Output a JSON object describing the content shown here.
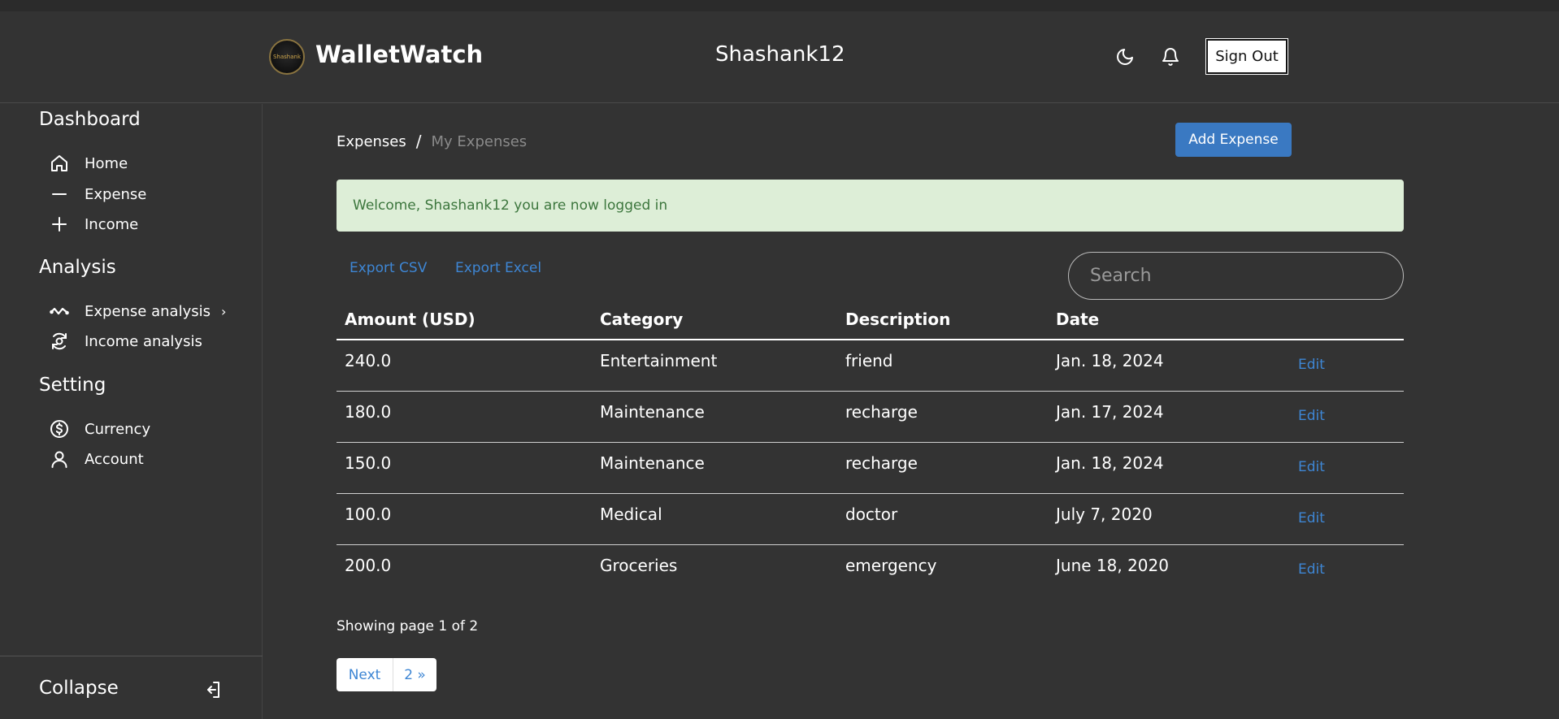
{
  "header": {
    "logo_text": "Shashank",
    "brand": "WalletWatch",
    "username": "Shashank12",
    "sign_out_label": "Sign Out",
    "icons": [
      "moon-icon",
      "bell-icon"
    ]
  },
  "sidebar": {
    "sections": [
      {
        "title": "Dashboard",
        "items": [
          {
            "label": "Home",
            "icon": "home-icon"
          },
          {
            "label": "Expense",
            "icon": "minus-icon"
          },
          {
            "label": "Income",
            "icon": "plus-icon"
          }
        ]
      },
      {
        "title": "Analysis",
        "items": [
          {
            "label": "Expense analysis",
            "icon": "wave-icon"
          },
          {
            "label": "Income analysis",
            "icon": "cycle-icon"
          }
        ]
      },
      {
        "title": "Setting",
        "items": [
          {
            "label": "Currency",
            "icon": "dollar-circle-icon"
          },
          {
            "label": "Account",
            "icon": "user-icon"
          }
        ]
      }
    ],
    "collapse_label": "Collapse"
  },
  "breadcrumb": {
    "root": "Expenses",
    "separator": "/",
    "current": "My Expenses"
  },
  "add_expense_label": "Add Expense",
  "alert_message": "Welcome, Shashank12 you are now logged in",
  "exports": {
    "csv": "Export CSV",
    "excel": "Export Excel"
  },
  "search": {
    "placeholder": "Search"
  },
  "table": {
    "columns": [
      "Amount (USD)",
      "Category",
      "Description",
      "Date"
    ],
    "rows": [
      {
        "amount": "240.0",
        "category": "Entertainment",
        "description": "friend",
        "date": "Jan. 18, 2024",
        "action": "Edit"
      },
      {
        "amount": "180.0",
        "category": "Maintenance",
        "description": "recharge",
        "date": "Jan. 17, 2024",
        "action": "Edit"
      },
      {
        "amount": "150.0",
        "category": "Maintenance",
        "description": "recharge",
        "date": "Jan. 18, 2024",
        "action": "Edit"
      },
      {
        "amount": "100.0",
        "category": "Medical",
        "description": "doctor",
        "date": "July 7, 2020",
        "action": "Edit"
      },
      {
        "amount": "200.0",
        "category": "Groceries",
        "description": "emergency",
        "date": "June 18, 2020",
        "action": "Edit"
      }
    ]
  },
  "pagination": {
    "info": "Showing page 1 of 2",
    "next_label": "Next",
    "page_two_label": "2 »"
  },
  "colors": {
    "background": "#333333",
    "accent": "#3a79c2",
    "link": "#3e86d4",
    "alert_bg": "#ddeed7",
    "alert_text": "#3c763d"
  }
}
